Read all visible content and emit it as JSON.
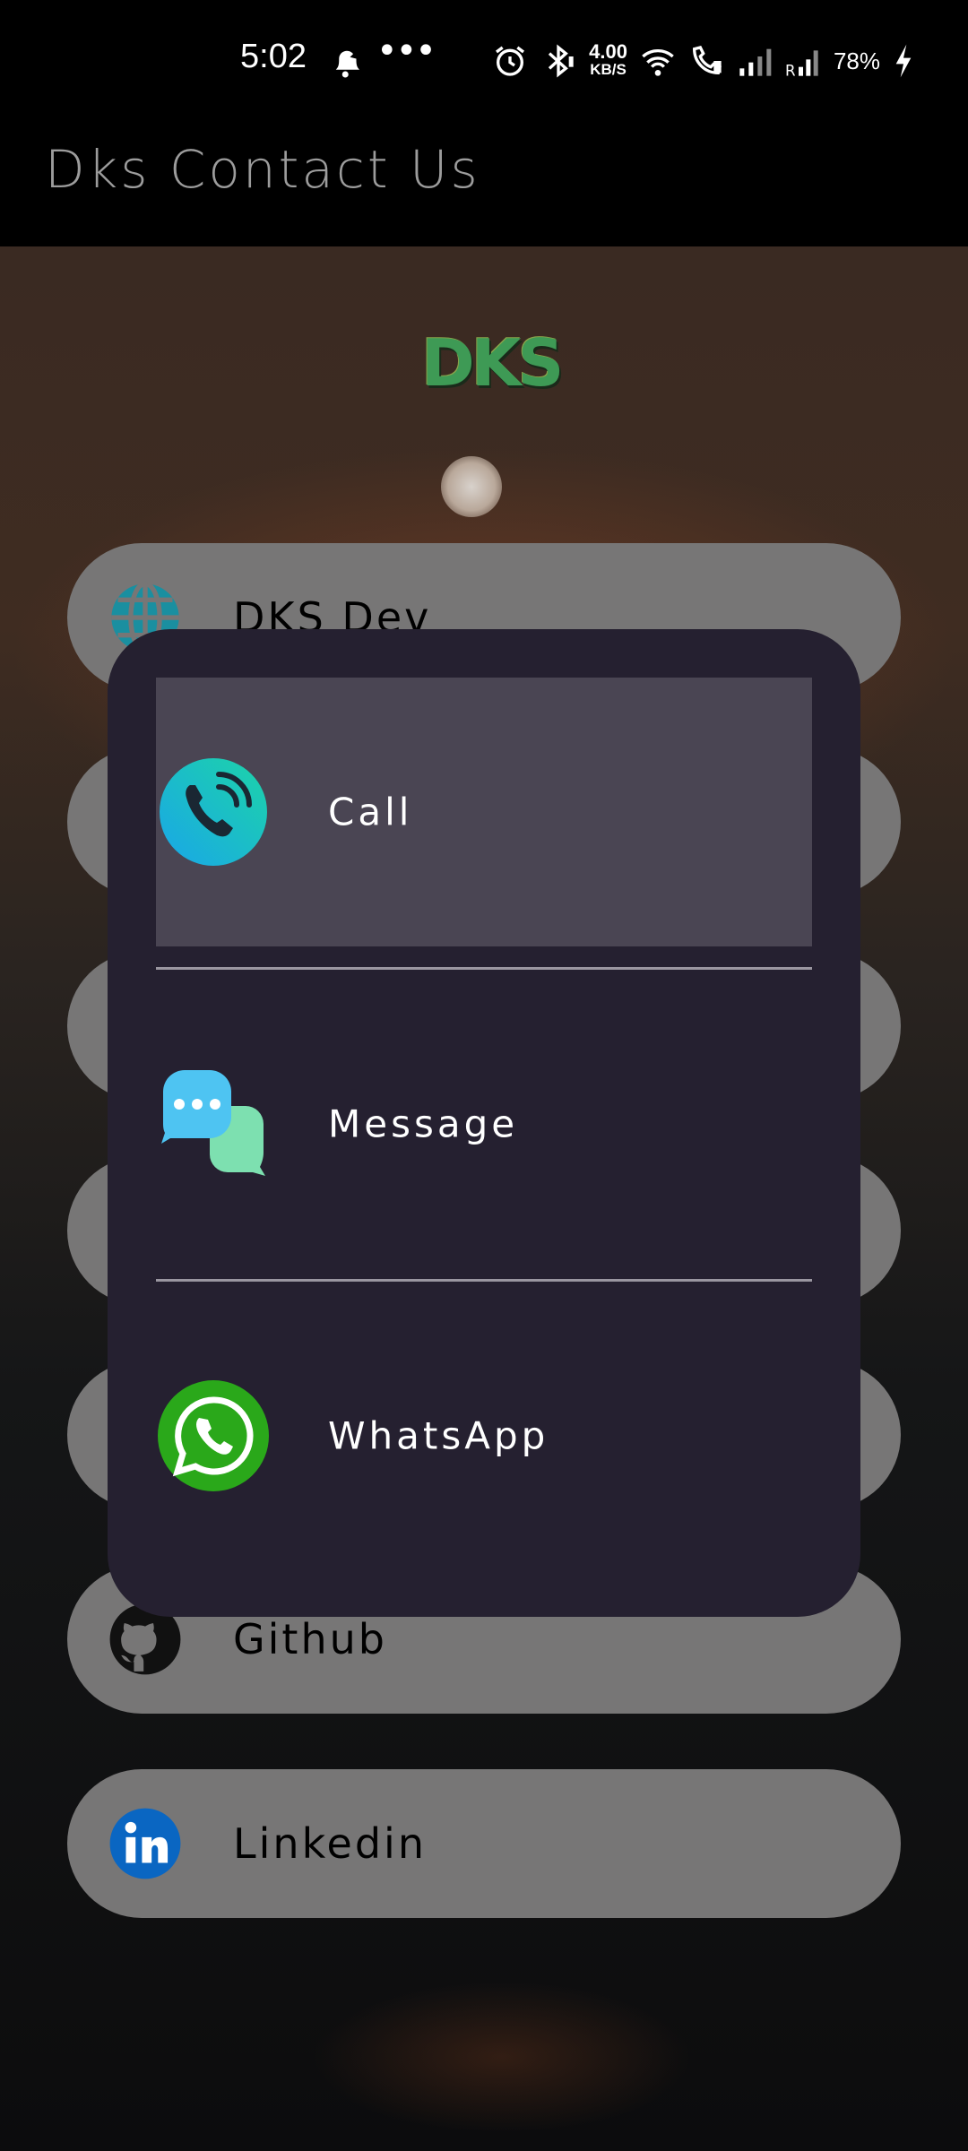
{
  "status_bar": {
    "time": "5:02",
    "more": "•••",
    "speed_value": "4.00",
    "speed_unit": "KB/S",
    "battery": "78%",
    "icons": [
      "notification-bell-icon",
      "alarm-icon",
      "bluetooth-icon",
      "wifi-icon",
      "wifi-calling-icon",
      "signal-icon",
      "signal-roaming-icon",
      "charging-icon"
    ]
  },
  "app_bar": {
    "title": "Dks Contact Us"
  },
  "header": {
    "logo_text": "DKS"
  },
  "menu": {
    "items": [
      {
        "label": "DKS Dev",
        "icon": "globe-icon"
      },
      {
        "label": "",
        "icon": ""
      },
      {
        "label": "",
        "icon": ""
      },
      {
        "label": "",
        "icon": ""
      },
      {
        "label": "",
        "icon": ""
      },
      {
        "label": "Github",
        "icon": "github-icon"
      },
      {
        "label": "Linkedin",
        "icon": "linkedin-icon"
      }
    ]
  },
  "dialog": {
    "options": [
      {
        "label": "Call",
        "icon": "phone-call-icon",
        "highlighted": true
      },
      {
        "label": "Message",
        "icon": "chat-bubble-icon",
        "highlighted": false
      },
      {
        "label": "WhatsApp",
        "icon": "whatsapp-icon",
        "highlighted": false
      }
    ]
  },
  "colors": {
    "dialog_bg": "#252030",
    "highlight_bg": "#4a4553",
    "pill_bg": "#777676",
    "whatsapp_green": "#2aa81a",
    "call_teal": "#17c6b0",
    "linkedin_blue": "#0a66c2"
  }
}
